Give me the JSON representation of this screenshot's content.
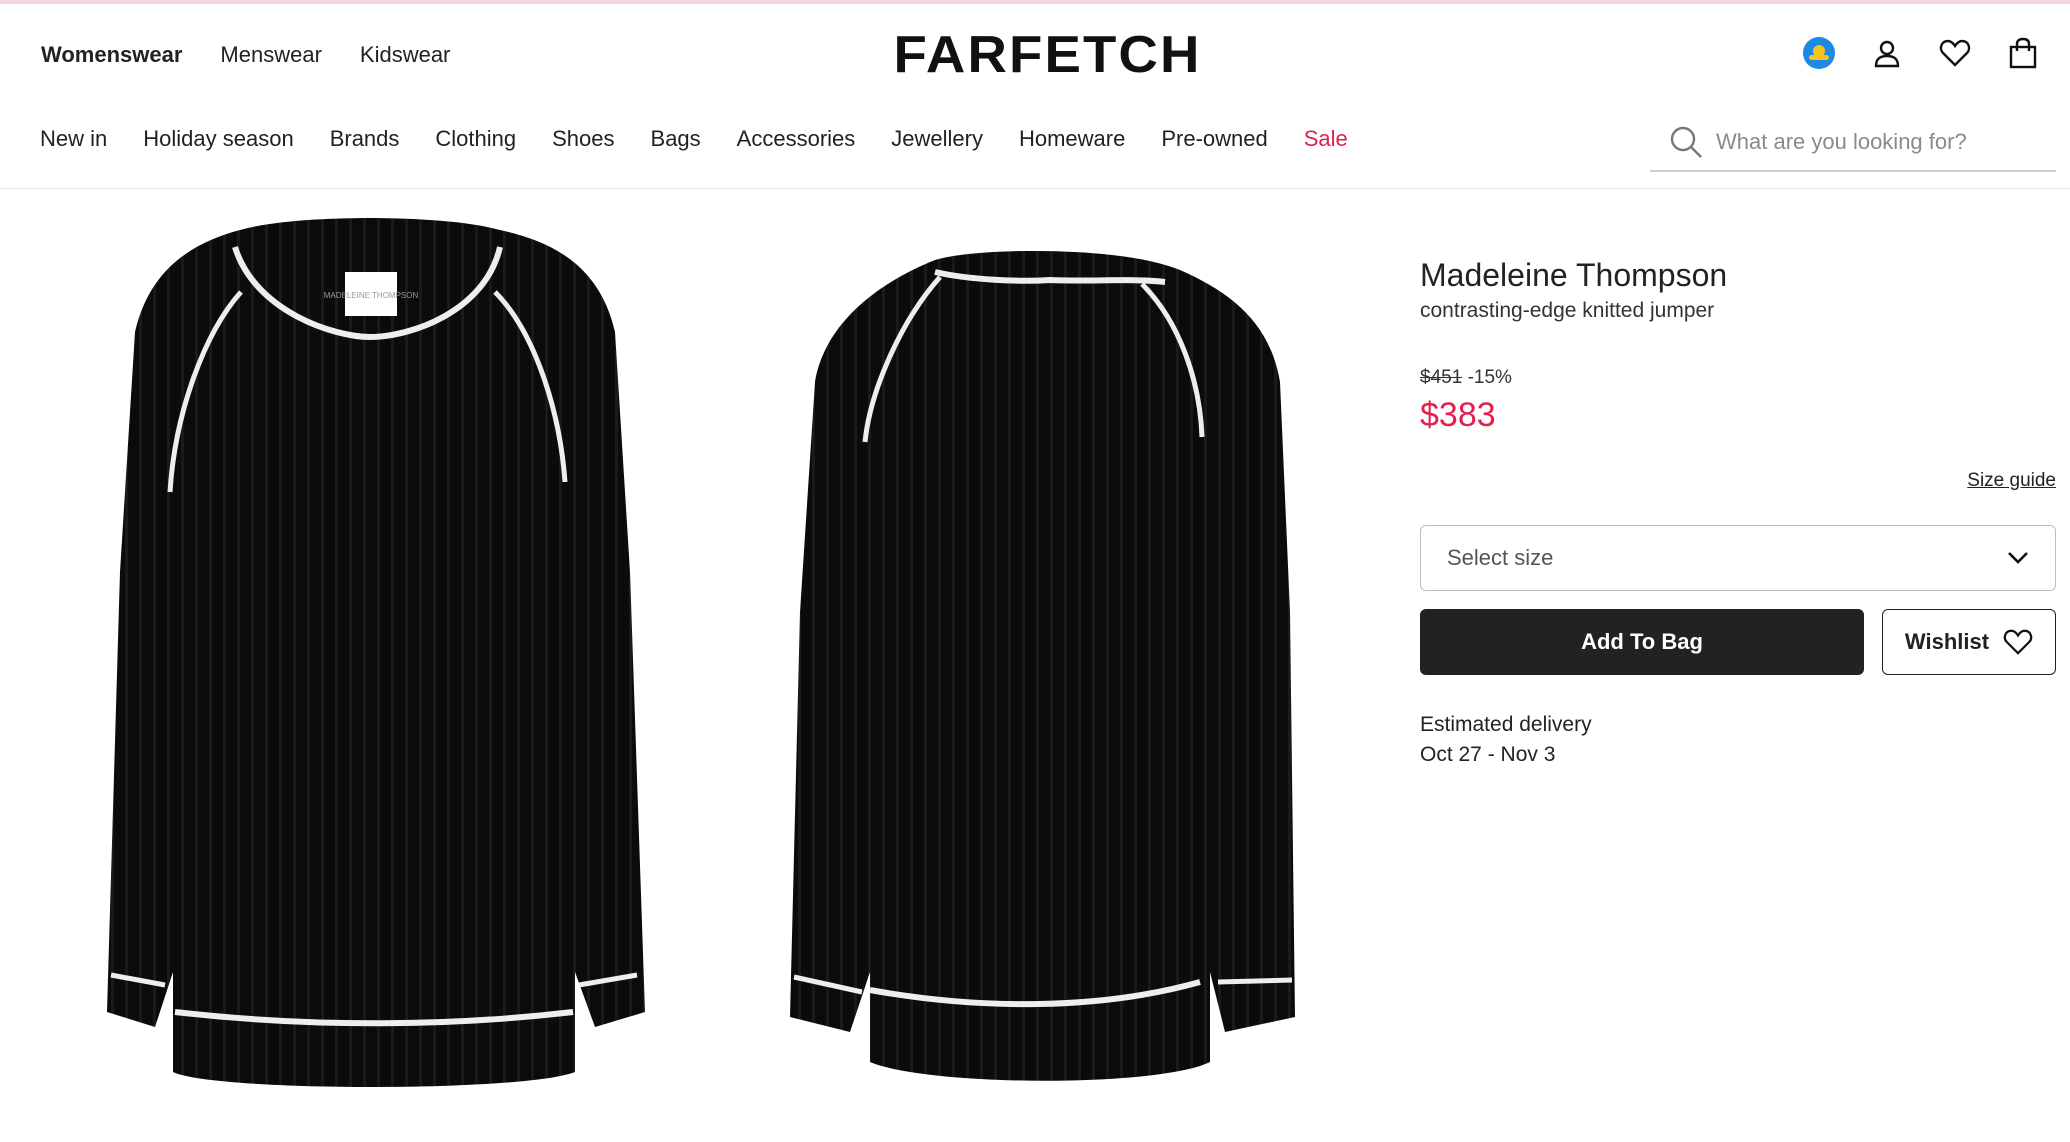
{
  "header": {
    "logo": "FARFETCH",
    "gender_tabs": [
      {
        "label": "Womenswear",
        "active": true
      },
      {
        "label": "Menswear",
        "active": false
      },
      {
        "label": "Kidswear",
        "active": false
      }
    ],
    "categories": [
      "New in",
      "Holiday season",
      "Brands",
      "Clothing",
      "Shoes",
      "Bags",
      "Accessories",
      "Jewellery",
      "Homeware",
      "Pre-owned",
      "Sale"
    ],
    "search": {
      "placeholder": "What are you looking for?"
    },
    "icons": [
      "region-flag-icon",
      "account-icon",
      "heart-icon",
      "bag-icon"
    ]
  },
  "product": {
    "brand": "Madeleine Thompson",
    "name": "contrasting-edge knitted jumper",
    "original_price": "$451",
    "discount": "-15%",
    "sale_price": "$383",
    "size_guide": "Size guide",
    "size_select_label": "Select size",
    "add_to_bag": "Add To Bag",
    "wishlist": "Wishlist",
    "delivery_label": "Estimated delivery",
    "delivery_dates": "Oct 27 - Nov 3",
    "label_text": "MADELEINE THOMPSON"
  },
  "colors": {
    "sale": "#e0214c",
    "primary_button": "#222222",
    "accent_bar": "#f3d6dd"
  }
}
